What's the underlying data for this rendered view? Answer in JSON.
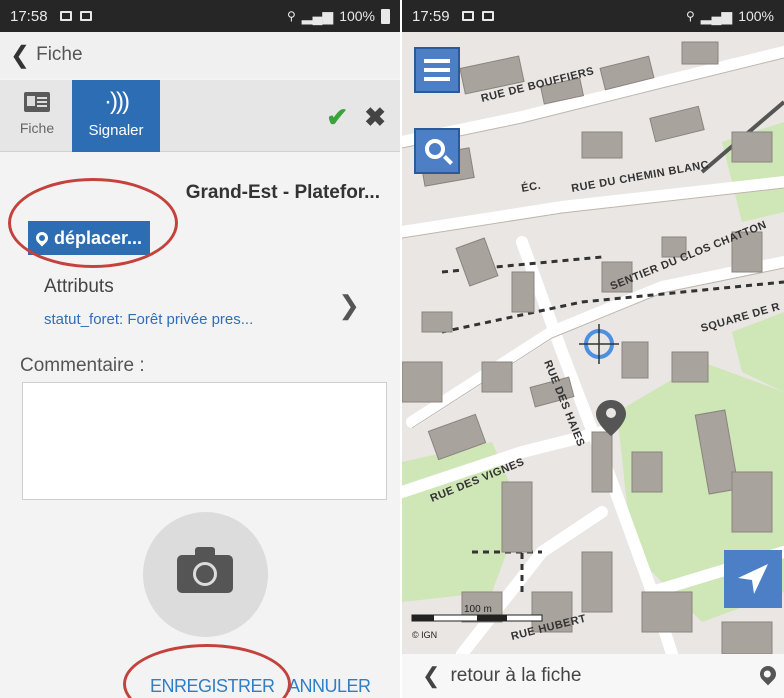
{
  "left": {
    "status": {
      "time": "17:58",
      "battery": "100%"
    },
    "header": {
      "back_label": "Fiche"
    },
    "tabs": [
      {
        "label": "Fiche"
      },
      {
        "label": "Signaler"
      }
    ],
    "place_title": "Grand-Est - Platefor...",
    "move_button": "déplacer...",
    "attributes": {
      "label": "Attributs",
      "value": "statut_foret: Forêt privée pres..."
    },
    "comment_label": "Commentaire :",
    "buttons": {
      "save": "ENREGISTRER",
      "cancel": "ANNULER"
    }
  },
  "right": {
    "status": {
      "time": "17:59",
      "battery": "100%"
    },
    "map": {
      "scale_label": "100 m",
      "credit": "© IGN",
      "streets": [
        "RUE DE BOUFFIERS",
        "ÉC.",
        "RUE DU CHEMIN BLANC",
        "SENTIER DU CLOS CHATTON",
        "SQUARE DE R",
        "RUE DES VIGNES",
        "RUE DES HAIES",
        "RUE HUBERT"
      ]
    },
    "footer": {
      "back_label": "retour à la fiche"
    }
  },
  "colors": {
    "primary": "#2d6db4",
    "map_button": "#4d7fc6",
    "link": "#2f7fc7",
    "annotation": "#c4413c",
    "confirm": "#3aa33a"
  }
}
